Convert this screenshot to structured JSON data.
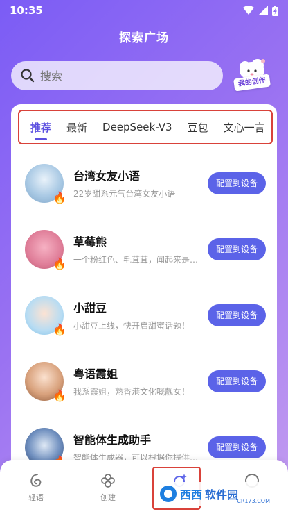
{
  "status_bar": {
    "time": "10:35"
  },
  "header": {
    "title": "探索广场"
  },
  "search": {
    "placeholder": "搜索"
  },
  "my_creation": {
    "label": "我的创作"
  },
  "tabs": [
    {
      "label": "推荐",
      "active": true
    },
    {
      "label": "最新",
      "active": false
    },
    {
      "label": "DeepSeek-V3",
      "active": false
    },
    {
      "label": "豆包",
      "active": false
    },
    {
      "label": "文心一言",
      "active": false
    }
  ],
  "list": [
    {
      "name": "台湾女友小语",
      "desc": "22岁甜系元气台湾女友小语",
      "button": "配置到设备",
      "avatar_color": "#8fb8d8"
    },
    {
      "name": "草莓熊",
      "desc": "一个粉红色、毛茸茸，闻起来是…",
      "button": "配置到设备",
      "avatar_color": "#e48aa5"
    },
    {
      "name": "小甜豆",
      "desc": "小甜豆上线，快开启甜蜜话题！",
      "button": "配置到设备",
      "avatar_color": "#9fd0ee"
    },
    {
      "name": "粤语霞姐",
      "desc": "我系霞姐，熟香港文化嘅靓女！",
      "button": "配置到设备",
      "avatar_color": "#d8a37e"
    },
    {
      "name": "智能体生成助手",
      "desc": "智能体生成器，可以根据你提供…",
      "button": "配置到设备",
      "avatar_color": "#4a6fa8"
    }
  ],
  "bottom_nav": [
    {
      "label": "轻语",
      "icon": "wave-icon"
    },
    {
      "label": "创建",
      "icon": "flower-icon"
    },
    {
      "label": "",
      "icon": "sparkle-icon"
    },
    {
      "label": "",
      "icon": "profile-icon"
    }
  ],
  "watermark": {
    "brand": "西西",
    "site": "软件园",
    "domain": "CR173.COM"
  },
  "colors": {
    "accent": "#5b63e8",
    "highlight_border": "#d9423a",
    "gradient_start": "#7b5cf5"
  }
}
